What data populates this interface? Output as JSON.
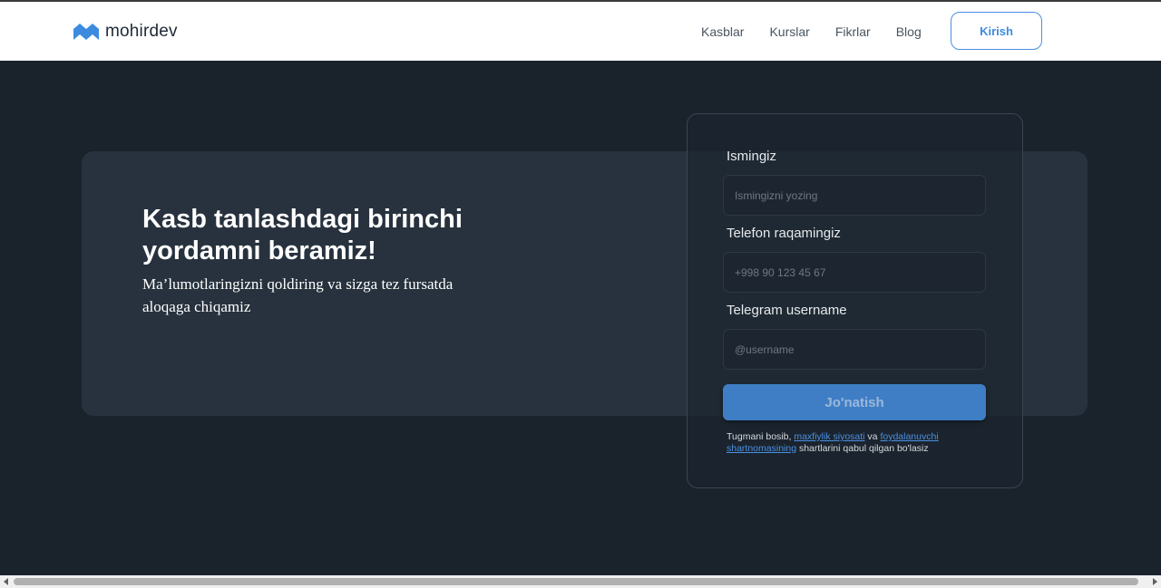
{
  "header": {
    "logo_text": "mohirdev",
    "nav": [
      "Kasblar",
      "Kurslar",
      "Fikrlar",
      "Blog"
    ],
    "login_label": "Kirish"
  },
  "hero": {
    "title": "Kasb tanlashdagi birinchi yordamni beramiz!",
    "subtitle": "Ma’lumotlaringizni qoldiring va sizga tez fursatda aloqaga chiqamiz"
  },
  "form": {
    "name_label": "Ismingiz",
    "name_placeholder": "Ismingizni yozing",
    "phone_label": "Telefon raqamingiz",
    "phone_placeholder": "+998 90 123 45 67",
    "telegram_label": "Telegram username",
    "telegram_placeholder": "@username",
    "submit_label": "Jo'natish",
    "terms_prefix": "Tugmani bosib, ",
    "terms_link1": "maxfiylik siyosati",
    "terms_middle": " va ",
    "terms_link2": "foydalanuvchi shartnomasining",
    "terms_suffix": " shartlarini qabul qilgan bo'lasiz"
  },
  "colors": {
    "background": "#1a222c",
    "card": "#27323e",
    "accent": "#4a90e2",
    "button": "#3f7ec4"
  }
}
